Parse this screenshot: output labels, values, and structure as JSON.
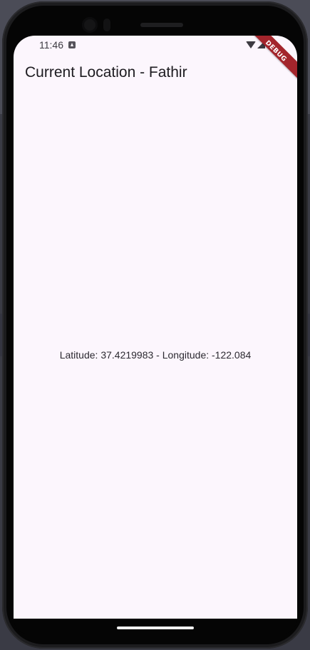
{
  "status_bar": {
    "time": "11:46",
    "icons": [
      "app-notification-icon",
      "wifi-icon",
      "signal-icon",
      "battery-icon"
    ]
  },
  "debug_banner": {
    "label": "DEBUG",
    "color": "#a3252c"
  },
  "app_bar": {
    "title": "Current Location - Fathir"
  },
  "main": {
    "location_text": "Latitude: 37.4219983 - Longitude: -122.084"
  },
  "colors": {
    "screen_background": "#fcf6fd",
    "title_text": "#1d1b20",
    "body_text": "#2c2a31",
    "phone_frame": "#1c1c1e"
  }
}
